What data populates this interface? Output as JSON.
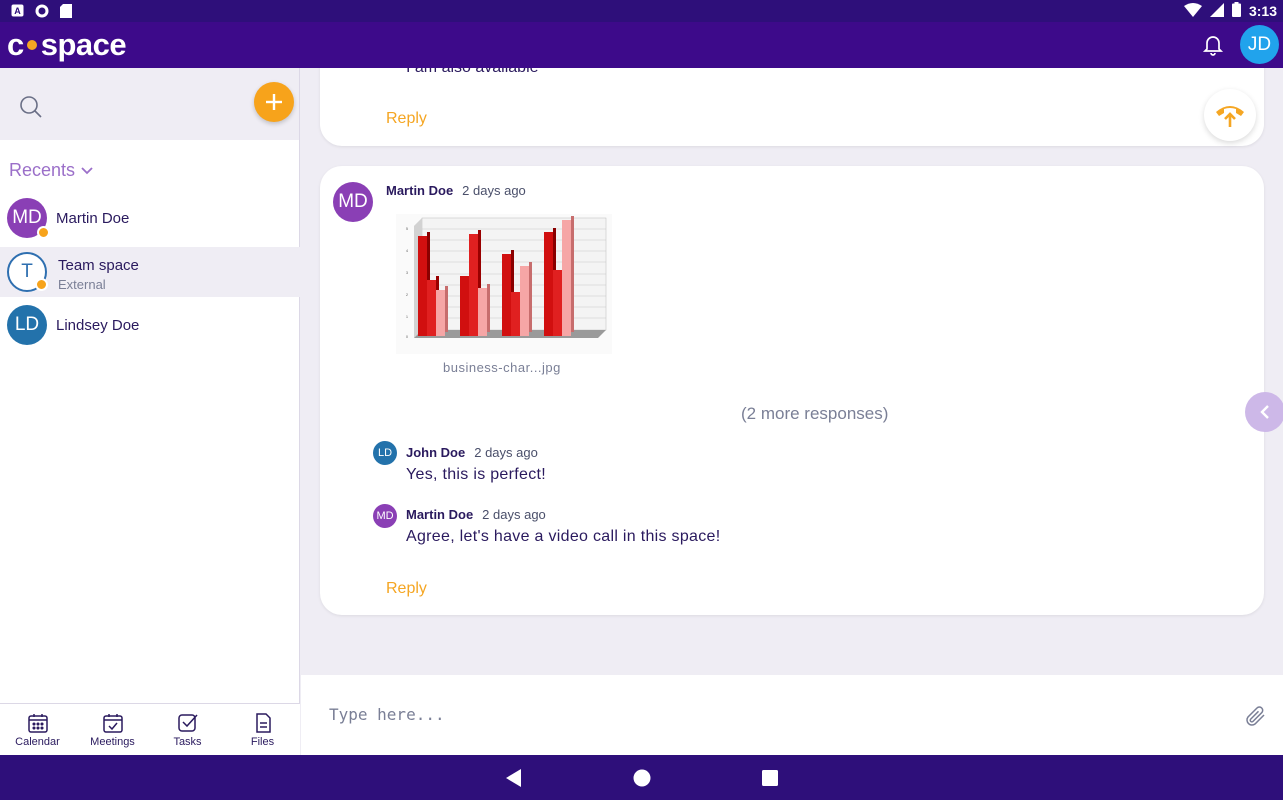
{
  "status_bar": {
    "time": "3:13"
  },
  "app": {
    "logo_left": "c",
    "logo_right": "space",
    "user_initials": "JD",
    "accent": "#f7a31b",
    "brand": "#3d0a8a"
  },
  "sidebar": {
    "recents_label": "Recents",
    "contacts": [
      {
        "initials": "MD",
        "name": "Martin Doe",
        "color": "#8a3fb5"
      },
      {
        "initials": "T",
        "name": "Team space",
        "subtitle": "External"
      },
      {
        "initials": "LD",
        "name": "Lindsey Doe",
        "color": "#2372ab"
      }
    ],
    "nav": [
      {
        "label": "Calendar",
        "icon": "calendar-icon"
      },
      {
        "label": "Meetings",
        "icon": "meetings-icon"
      },
      {
        "label": "Tasks",
        "icon": "tasks-icon"
      },
      {
        "label": "Files",
        "icon": "files-icon"
      }
    ]
  },
  "thread": {
    "prev_message_text": "I am also available",
    "reply_label": "Reply",
    "post": {
      "author_initials": "MD",
      "author": "Martin Doe",
      "time": "2 days ago",
      "attachment_name": "business-char...jpg",
      "more_responses": "(2 more responses)"
    },
    "responses": [
      {
        "initials": "LD",
        "author": "John Doe",
        "time": "2 days ago",
        "text": "Yes, this is perfect!",
        "color": "#2372ab"
      },
      {
        "initials": "MD",
        "author": "Martin Doe",
        "time": "2 days ago",
        "text": "Agree, let's have a video call in this space!",
        "color": "#8a3fb5"
      }
    ]
  },
  "composer": {
    "placeholder": "Type here..."
  }
}
